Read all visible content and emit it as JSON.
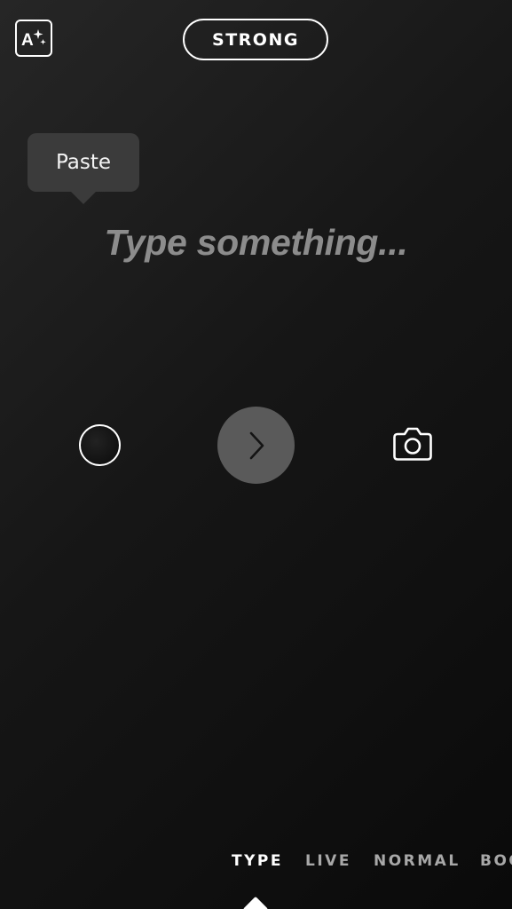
{
  "topbar": {
    "font_effects_icon": "font-sparkle-icon",
    "style_label": "STRONG"
  },
  "tooltip": {
    "paste_label": "Paste"
  },
  "editor": {
    "placeholder": "Type something..."
  },
  "controls": {
    "color_picker_icon": "color-circle-icon",
    "color_value": "#0d0d0d",
    "next_icon": "chevron-right-icon",
    "camera_icon": "camera-icon"
  },
  "modes": {
    "items": [
      {
        "label": "TYPE",
        "active": true
      },
      {
        "label": "LIVE",
        "active": false
      },
      {
        "label": "NORMAL",
        "active": false
      },
      {
        "label": "BOO",
        "active": false
      }
    ]
  },
  "colors": {
    "background": "#161616",
    "placeholder": "#8c8c8c",
    "tooltip_bg": "#3b3b3b",
    "next_button_bg": "#5a5a5a",
    "inactive_mode": "#a8a8a8"
  }
}
